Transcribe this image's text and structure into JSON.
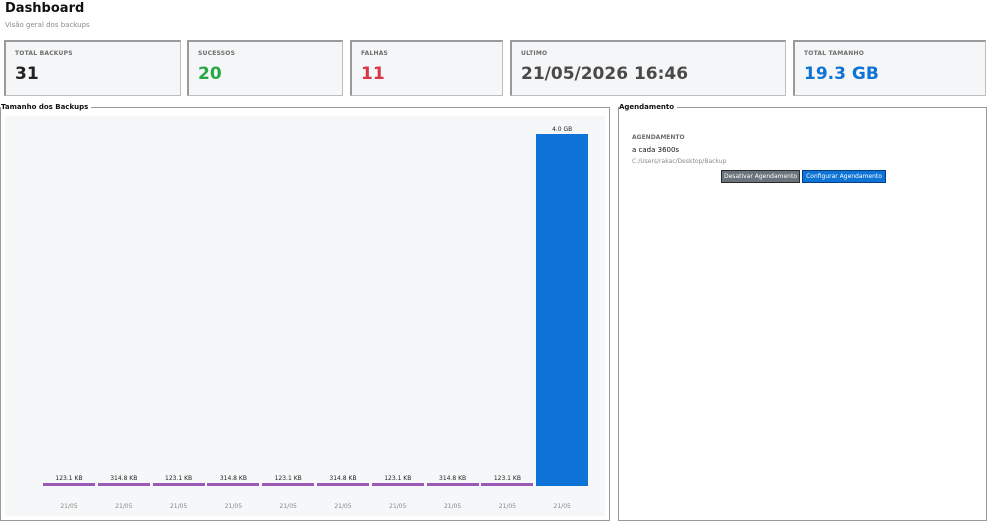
{
  "header": {
    "title": "Dashboard",
    "subtitle": "Visão geral dos backups"
  },
  "cards": [
    {
      "label": "TOTAL BACKUPS",
      "value": "31",
      "color": "#222222"
    },
    {
      "label": "SUCESSOS",
      "value": "20",
      "color": "#28a745"
    },
    {
      "label": "FALHAS",
      "value": "11",
      "color": "#dc3545"
    },
    {
      "label": "ULTIMO",
      "value": "21/05/2026 16:46",
      "color": "#4a4a4a"
    },
    {
      "label": "TOTAL TAMANHO",
      "value": "19.3 GB",
      "color": "#0d73d6"
    }
  ],
  "chart_panel": {
    "title": "Tamanho dos Backups"
  },
  "schedule_panel": {
    "title": "Agendamento",
    "heading": "AGENDAMENTO",
    "interval": "a cada 3600s",
    "path": "C:/Users/rakac/Desktop/Backup",
    "disable_label": "Desativar Agendamento",
    "configure_label": "Configurar Agendamento"
  },
  "chart_data": {
    "type": "bar",
    "categories": [
      "21/05",
      "21/05",
      "21/05",
      "21/05",
      "21/05",
      "21/05",
      "21/05",
      "21/05",
      "21/05",
      "21/05"
    ],
    "values_kb": [
      123.1,
      314.8,
      123.1,
      314.8,
      123.1,
      314.8,
      123.1,
      314.8,
      123.1,
      4194304
    ],
    "data_labels": [
      "123.1 KB",
      "314.8 KB",
      "123.1 KB",
      "314.8 KB",
      "123.1 KB",
      "314.8 KB",
      "123.1 KB",
      "314.8 KB",
      "123.1 KB",
      "4.0 GB"
    ],
    "bar_colors": [
      "#9b59b6",
      "#9b59b6",
      "#9b59b6",
      "#9b59b6",
      "#9b59b6",
      "#9b59b6",
      "#9b59b6",
      "#9b59b6",
      "#9b59b6",
      "#0d73d6"
    ],
    "title": "",
    "xlabel": "",
    "ylabel": ""
  }
}
